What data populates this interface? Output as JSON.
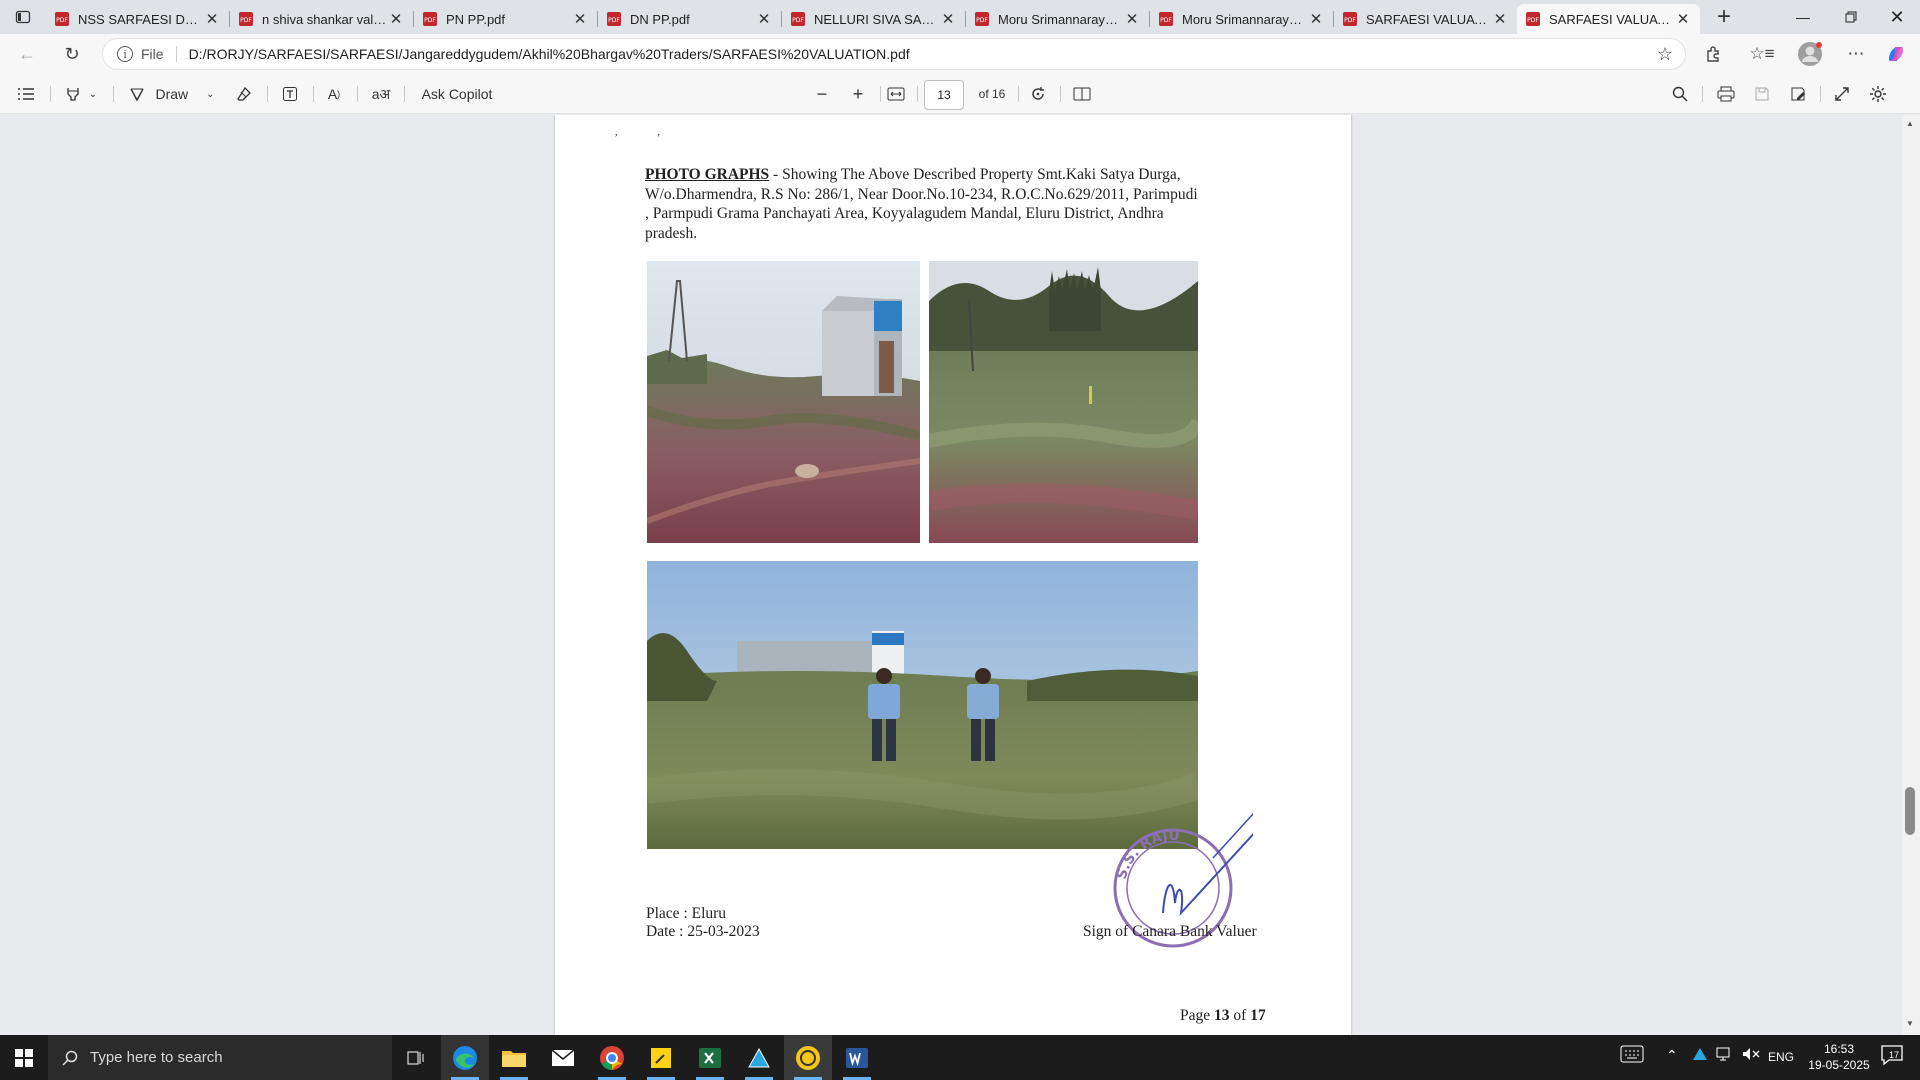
{
  "tabs": [
    {
      "label": "NSS SARFAESI DEMAN",
      "active": false
    },
    {
      "label": "n shiva shankar valuatio",
      "active": false
    },
    {
      "label": "PN PP.pdf",
      "active": false
    },
    {
      "label": "DN PP.pdf",
      "active": false
    },
    {
      "label": "NELLURI SIVA SANKAR",
      "active": false
    },
    {
      "label": "Moru Srimannarayana",
      "active": false
    },
    {
      "label": "Moru Srimannarayana",
      "active": false
    },
    {
      "label": "SARFAESI VALUATION.p",
      "active": false
    },
    {
      "label": "SARFAESI VALUATION.p",
      "active": true
    }
  ],
  "address": {
    "scheme_label": "File",
    "url": "D:/RORJY/SARFAESI/SARFAESI/Jangareddygudem/Akhil%20Bhargav%20Traders/SARFAESI%20VALUATION.pdf"
  },
  "pdf_toolbar": {
    "draw_label": "Draw",
    "copilot_label": "Ask Copilot",
    "page_current": "13",
    "page_total": "of 16"
  },
  "document": {
    "heading": "PHOTO GRAPHS",
    "description": " - Showing The Above Described Property Smt.Kaki Satya Durga, W/o.Dharmendra, R.S No: 286/1,  Near Door.No.10-234, R.O.C.No.629/2011, Parimpudi , Parmpudi Grama Panchayati  Area, Koyyalagudem Mandal, Eluru District, Andhra pradesh.",
    "place": "Place : Eluru",
    "date": "Date  : 25-03-2023",
    "signature_label": "Sign of Canara  Bank Valuer",
    "stamp_text": "S.S. RAJU",
    "page_footer_prefix": "Page ",
    "page_footer_num": "13",
    "page_footer_mid": " of ",
    "page_footer_total": "17"
  },
  "taskbar": {
    "search_placeholder": "Type here to search",
    "time": "16:53",
    "date": "19-05-2025",
    "language": "ENG",
    "notification_count": "17"
  },
  "colors": {
    "accent": "#0067c0",
    "pdf_icon": "#c1272d",
    "taskbar": "#1c1c1c"
  }
}
